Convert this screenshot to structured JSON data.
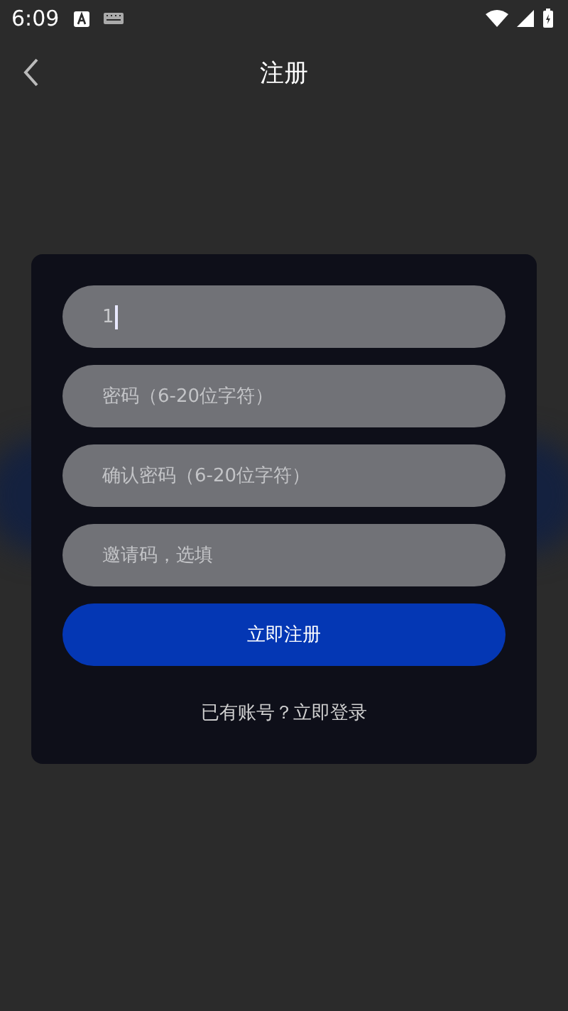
{
  "status_bar": {
    "time": "6:09"
  },
  "header": {
    "title": "注册"
  },
  "fields": [
    {
      "value": "1",
      "focused": true
    },
    {
      "placeholder": "密码（6-20位字符）",
      "focused": false
    },
    {
      "placeholder": "确认密码（6-20位字符）",
      "focused": false
    },
    {
      "placeholder": "邀请码，选填",
      "focused": false
    }
  ],
  "submit_button": "立即注册",
  "login_link": "已有账号？立即登录"
}
